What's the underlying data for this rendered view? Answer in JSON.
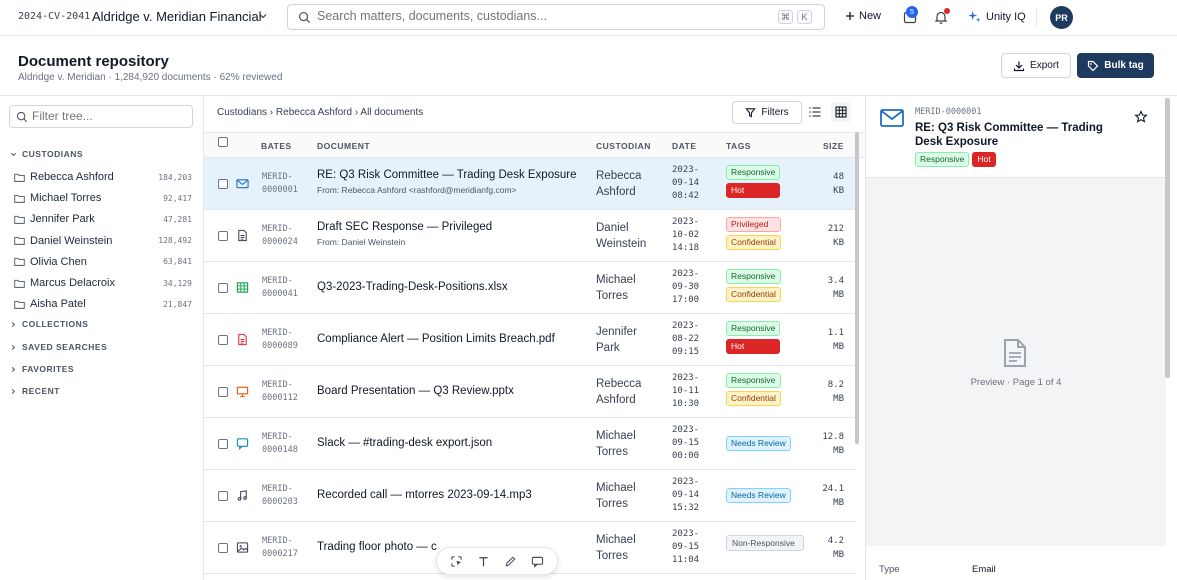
{
  "topbar": {
    "matter_id": "2024-CV-2041",
    "matter_name": "Aldridge v. Meridian Financial",
    "search_placeholder": "Search matters, documents, custodians...",
    "kbd_mod": "⌘",
    "kbd_key": "K",
    "new_label": "New",
    "inbox_count": "5",
    "unity_label": "Unity IQ",
    "avatar_initials": "PR"
  },
  "header": {
    "title": "Document repository",
    "subtitle": "Aldridge v. Meridian · 1,284,920 documents · 62% reviewed",
    "export_label": "Export",
    "bulk_tag_label": "Bulk tag"
  },
  "sidebar": {
    "filter_placeholder": "Filter tree...",
    "custodians_label": "CUSTODIANS",
    "custodians": [
      {
        "name": "Rebecca Ashford",
        "count": "184,203"
      },
      {
        "name": "Michael Torres",
        "count": "92,417"
      },
      {
        "name": "Jennifer Park",
        "count": "47,281"
      },
      {
        "name": "Daniel Weinstein",
        "count": "128,492"
      },
      {
        "name": "Olivia Chen",
        "count": "63,841"
      },
      {
        "name": "Marcus Delacroix",
        "count": "34,129"
      },
      {
        "name": "Aisha Patel",
        "count": "21,847"
      }
    ],
    "collections_label": "COLLECTIONS",
    "saved_searches_label": "SAVED SEARCHES",
    "favorites_label": "FAVORITES",
    "recent_label": "RECENT"
  },
  "main": {
    "breadcrumb": "Custodians › Rebecca Ashford › All documents",
    "filters_label": "Filters",
    "columns": {
      "bates": "BATES",
      "document": "DOCUMENT",
      "custodian": "CUSTODIAN",
      "date": "DATE",
      "tags": "TAGS",
      "size": "SIZE"
    },
    "rows": [
      {
        "bates1": "MERID-",
        "bates2": "0000001",
        "doc": "RE: Q3 Risk Committee — Trading Desk Exposure",
        "from": "From: Rebecca Ashford <rashford@meridianfg.com>",
        "cust1": "Rebecca",
        "cust2": "Ashford",
        "d1": "2023-",
        "d2": "09-14",
        "d3": "08:42",
        "tag1": "Responsive",
        "tag2": "Hot",
        "s1": "48",
        "s2": "KB",
        "icon": "mail-icon"
      },
      {
        "bates1": "MERID-",
        "bates2": "0000024",
        "doc": "Draft SEC Response — Privileged",
        "from": "From: Daniel Weinstein",
        "cust1": "Daniel",
        "cust2": "Weinstein",
        "d1": "2023-",
        "d2": "10-02",
        "d3": "14:18",
        "tag1": "Privileged",
        "tag2": "Confidential",
        "s1": "212",
        "s2": "KB",
        "icon": "document-icon"
      },
      {
        "bates1": "MERID-",
        "bates2": "0000041",
        "doc": "Q3-2023-Trading-Desk-Positions.xlsx",
        "from": "",
        "cust1": "Michael",
        "cust2": "Torres",
        "d1": "2023-",
        "d2": "09-30",
        "d3": "17:00",
        "tag1": "Responsive",
        "tag2": "Confidential",
        "s1": "3.4",
        "s2": "MB",
        "icon": "spreadsheet-icon"
      },
      {
        "bates1": "MERID-",
        "bates2": "0000089",
        "doc": "Compliance Alert — Position Limits Breach.pdf",
        "from": "",
        "cust1": "Jennifer",
        "cust2": "Park",
        "d1": "2023-",
        "d2": "08-22",
        "d3": "09:15",
        "tag1": "Responsive",
        "tag2": "Hot",
        "s1": "1.1",
        "s2": "MB",
        "icon": "pdf-icon"
      },
      {
        "bates1": "MERID-",
        "bates2": "0000112",
        "doc": "Board Presentation — Q3 Review.pptx",
        "from": "",
        "cust1": "Rebecca",
        "cust2": "Ashford",
        "d1": "2023-",
        "d2": "10-11",
        "d3": "10:30",
        "tag1": "Responsive",
        "tag2": "Confidential",
        "s1": "8.2",
        "s2": "MB",
        "icon": "presentation-icon"
      },
      {
        "bates1": "MERID-",
        "bates2": "0000148",
        "doc": "Slack — #trading-desk export.json",
        "from": "",
        "cust1": "Michael",
        "cust2": "Torres",
        "d1": "2023-",
        "d2": "09-15",
        "d3": "00:00",
        "tag1": "Needs Review",
        "tag2": "",
        "s1": "12.8",
        "s2": "MB",
        "icon": "chat-icon"
      },
      {
        "bates1": "MERID-",
        "bates2": "0000203",
        "doc": "Recorded call — mtorres 2023-09-14.mp3",
        "from": "",
        "cust1": "Michael",
        "cust2": "Torres",
        "d1": "2023-",
        "d2": "09-14",
        "d3": "15:32",
        "tag1": "Needs Review",
        "tag2": "",
        "s1": "24.1",
        "s2": "MB",
        "icon": "audio-icon"
      },
      {
        "bates1": "MERID-",
        "bates2": "0000217",
        "doc": "Trading floor photo — c",
        "from": "",
        "cust1": "Michael",
        "cust2": "Torres",
        "d1": "2023-",
        "d2": "09-15",
        "d3": "11:04",
        "tag1": "Non-Responsive",
        "tag2": "",
        "s1": "4.2",
        "s2": "MB",
        "icon": "image-icon"
      }
    ]
  },
  "preview": {
    "bates": "MERID-0000001",
    "title": "RE: Q3 Risk Committee — Trading Desk Exposure",
    "tag1": "Responsive",
    "tag2": "Hot",
    "page_label": "Preview · Page 1 of 4",
    "meta_key": "Type",
    "meta_val": "Email"
  },
  "colors": {
    "accent": "#1e3a5f",
    "selected_row": "#e6f2fb",
    "hot": "#dc2626",
    "link_blue": "#2563eb"
  }
}
